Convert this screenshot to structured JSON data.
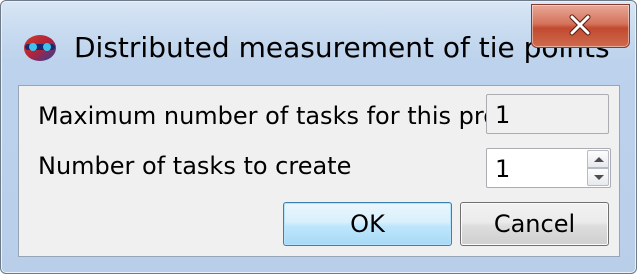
{
  "window": {
    "title": "Distributed measurement of tie points",
    "app_icon": "blue-red-sphere-with-glasses-icon",
    "close_icon": "close-x-icon"
  },
  "form": {
    "max_tasks_label": "Maximum number of tasks for this project",
    "max_tasks_value": "1",
    "tasks_to_create_label": "Number of tasks to create",
    "tasks_to_create_value": "1"
  },
  "buttons": {
    "ok_label": "OK",
    "cancel_label": "Cancel"
  },
  "colors": {
    "close_button": "#c14a2f",
    "default_button_border": "#3c7fb1"
  }
}
